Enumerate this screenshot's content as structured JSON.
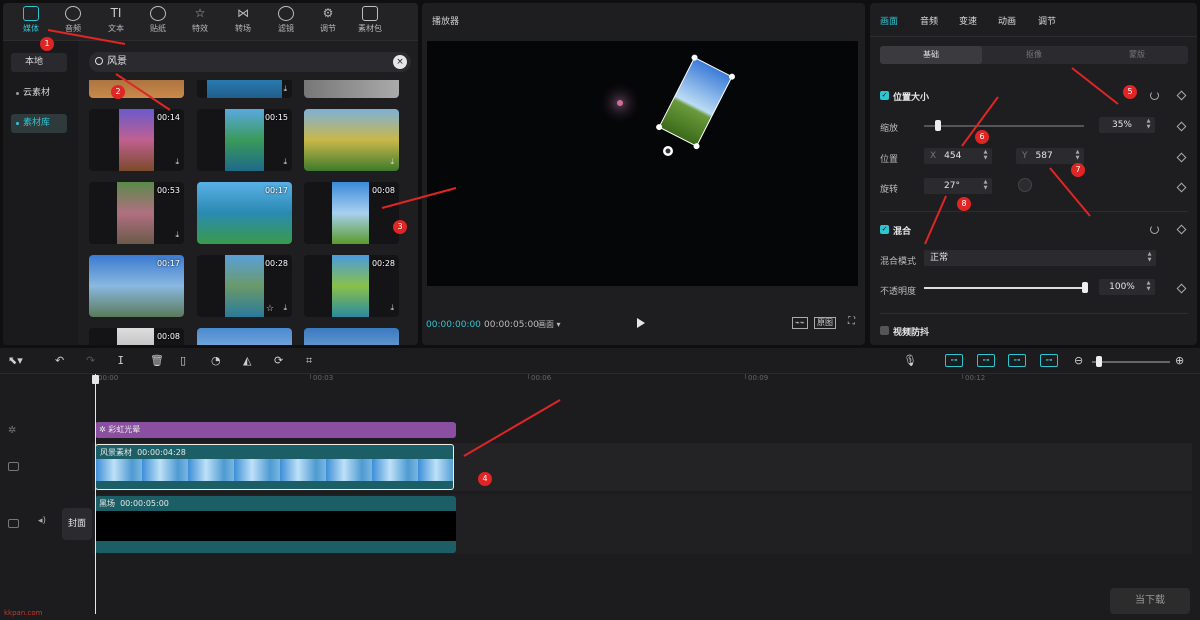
{
  "media_panel": {
    "categories": [
      {
        "label": "媒体",
        "icon": "media-icon",
        "active": true
      },
      {
        "label": "音频",
        "icon": "audio-icon"
      },
      {
        "label": "文本",
        "icon": "text-icon"
      },
      {
        "label": "贴纸",
        "icon": "sticker-icon"
      },
      {
        "label": "特效",
        "icon": "effects-icon"
      },
      {
        "label": "转场",
        "icon": "transition-icon"
      },
      {
        "label": "滤镜",
        "icon": "filter-icon"
      },
      {
        "label": "调节",
        "icon": "adjust-icon"
      },
      {
        "label": "素材包",
        "icon": "package-icon"
      }
    ],
    "sidebar": {
      "local": "本地",
      "cloud": "云素材",
      "library": "素材库"
    },
    "search": {
      "value": "风景",
      "clear_icon": "×"
    },
    "thumbs": [
      {
        "duration": "00:14"
      },
      {
        "duration": "00:15"
      },
      {
        "duration": ""
      },
      {
        "duration": "00:53"
      },
      {
        "duration": "00:17"
      },
      {
        "duration": "00:08"
      },
      {
        "duration": "00:17"
      },
      {
        "duration": "00:28"
      },
      {
        "duration": "00:28"
      },
      {
        "duration": "00:08"
      }
    ]
  },
  "player": {
    "title": "播放器",
    "current_time": "00:00:00:00",
    "total_time": "00:00:05:00",
    "ratio_label": "画面",
    "original_label": "原图"
  },
  "properties": {
    "tabs": [
      "画面",
      "音频",
      "变速",
      "动画",
      "调节"
    ],
    "segments": [
      "基础",
      "抠像",
      "蒙版"
    ],
    "position_size": {
      "title": "位置大小",
      "scale_label": "缩放",
      "scale_value": "35%",
      "scale_fraction": 0.09,
      "position_label": "位置",
      "x_prefix": "X",
      "x_value": "454",
      "y_prefix": "Y",
      "y_value": "587",
      "rotate_label": "旋转",
      "rotate_value": "27°"
    },
    "blend": {
      "title": "混合",
      "mode_label": "混合模式",
      "mode_value": "正常",
      "opacity_label": "不透明度",
      "opacity_value": "100%",
      "opacity_fraction": 1.0
    },
    "stabilize": {
      "title": "视频防抖"
    }
  },
  "timeline": {
    "ruler_ticks": [
      "00:00",
      "00:03",
      "00:06",
      "00:09",
      "00:12"
    ],
    "tracks": {
      "effect_clip": {
        "label": "彩虹光晕"
      },
      "video_clip": {
        "label": "风景素材",
        "duration": "00:00:04:28"
      },
      "black_clip": {
        "label": "黑场",
        "duration": "00:00:05:00"
      }
    },
    "cover_label": "封面"
  },
  "annotations": [
    "1",
    "2",
    "3",
    "4",
    "5",
    "6",
    "7",
    "8"
  ],
  "watermark": {
    "left": "kkpan.com",
    "right": "当下载"
  },
  "colors": {
    "accent": "#2ec5d3",
    "marker": "#e02525",
    "effect_clip": "#8a4fa0",
    "video_clip": "#1b5e65"
  }
}
